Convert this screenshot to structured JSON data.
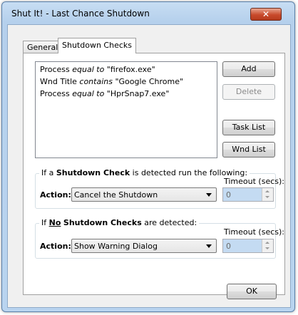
{
  "window": {
    "title": "Shut It! - Last Chance Shutdown",
    "close_glyph": "✕"
  },
  "tabs": [
    {
      "label": "General",
      "active": false
    },
    {
      "label": "Shutdown Checks",
      "active": true
    }
  ],
  "checks_list": [
    {
      "field": "Process",
      "op": "equal to",
      "value": "\"firefox.exe\""
    },
    {
      "field": "Wnd Title",
      "op": "contains",
      "value": "\"Google Chrome\""
    },
    {
      "field": "Process",
      "op": "equal to",
      "value": "\"HprSnap7.exe\""
    }
  ],
  "buttons": {
    "add": "Add",
    "delete": "Delete",
    "task_list": "Task List",
    "wnd_list": "Wnd List",
    "ok": "OK"
  },
  "group_detected": {
    "caption_prefix": "If a",
    "caption_bold": "Shutdown Check",
    "caption_suffix": "is detected run the following:",
    "action_label": "Action:",
    "action_value": "Cancel the Shutdown",
    "timeout_label": "Timeout (secs):",
    "timeout_value": "0"
  },
  "group_none": {
    "caption_prefix": "If",
    "caption_no": "No",
    "caption_bold": "Shutdown Checks",
    "caption_suffix": "are detected:",
    "action_label": "Action:",
    "action_value": "Show Warning Dialog",
    "timeout_label": "Timeout (secs):",
    "timeout_value": "0"
  },
  "colors": {
    "titlebar": "#b9d4ef",
    "close_button": "#c84a2c",
    "spin_field": "#c4dbf2"
  }
}
